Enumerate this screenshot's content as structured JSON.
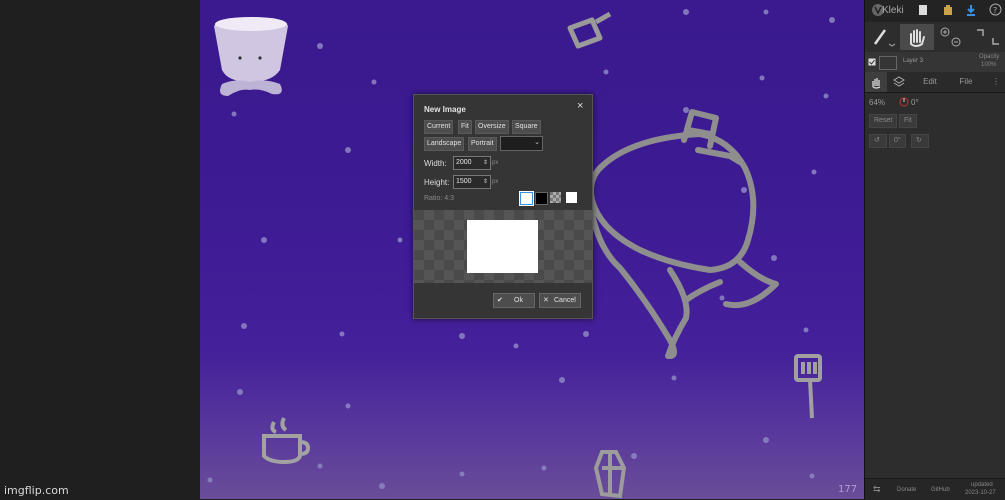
{
  "watermark": "imgflip.com",
  "app": {
    "title": "Kleki"
  },
  "layer": {
    "name": "Layer 3",
    "opacity_label": "Opacity",
    "opacity_value": "100%"
  },
  "tabs": [
    {
      "label": "Edit"
    },
    {
      "label": "File"
    }
  ],
  "view": {
    "zoom": "64%",
    "rotation": "0°",
    "reset_label": "Reset",
    "fit_label": "Fit",
    "rotate_value": "0°"
  },
  "footer": {
    "donate": "Donate",
    "github": "GitHub",
    "updated": "updated",
    "date": "2023-10-27"
  },
  "dialog": {
    "title": "New Image",
    "close": "×",
    "presets_row1": [
      "Current",
      "Fit",
      "Oversize",
      "Square"
    ],
    "presets_row2": [
      "Landscape",
      "Portrait"
    ],
    "width_label": "Width:",
    "width_value": "2000",
    "height_label": "Height:",
    "height_value": "1500",
    "unit": "px",
    "ratio": "Ratio: 4:3",
    "ok_label": "Ok",
    "cancel_label": "Cancel",
    "background_colors": [
      "#ffffff",
      "#000000",
      "transparent",
      "#ffffff"
    ]
  },
  "canvas_signature": "177"
}
